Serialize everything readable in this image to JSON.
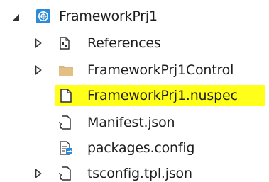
{
  "tree": {
    "root": {
      "label": "FrameworkPrj1",
      "expanded": true,
      "icon": "project-icon",
      "children": [
        {
          "label": "References",
          "icon": "references-icon",
          "expandable": true,
          "expanded": false
        },
        {
          "label": "FrameworkPrj1Control",
          "icon": "folder-icon",
          "expandable": true,
          "expanded": false
        },
        {
          "label": "FrameworkPrj1.nuspec",
          "icon": "file-icon",
          "expandable": false,
          "highlighted": true,
          "highlight_color": "#FFFF1A"
        },
        {
          "label": "Manifest.json",
          "icon": "json-file-icon",
          "expandable": false
        },
        {
          "label": "packages.config",
          "icon": "config-file-icon",
          "expandable": false
        },
        {
          "label": "tsconfig.tpl.json",
          "icon": "json-file-icon",
          "expandable": true,
          "expanded": false
        }
      ]
    }
  },
  "colors": {
    "highlight": "#FFFF1A",
    "folder": "#DCB67A",
    "project_badge": "#2B8BD9",
    "expander": "#333333"
  }
}
